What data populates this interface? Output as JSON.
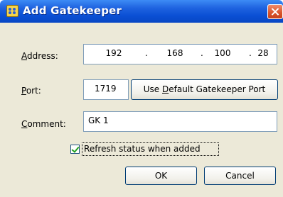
{
  "window": {
    "title": "Add Gatekeeper"
  },
  "address": {
    "label_mnemonic": "A",
    "label_rest": "ddress:",
    "octets": [
      "192",
      "168",
      "100",
      "28"
    ],
    "separator": "."
  },
  "port": {
    "label_mnemonic": "P",
    "label_rest": "ort:",
    "value": "1719",
    "default_button_pre": "Use ",
    "default_button_mnemonic": "D",
    "default_button_post": "efault Gatekeeper Port"
  },
  "comment": {
    "label_mnemonic": "C",
    "label_rest": "omment:",
    "value": "GK 1"
  },
  "refresh_checkbox": {
    "label_mnemonic": "R",
    "label_rest": "efresh status when added",
    "checked": true
  },
  "buttons": {
    "ok_label": "OK",
    "cancel_label": "Cancel"
  },
  "colors": {
    "titlebar": "#0a4fd4",
    "dialog_bg": "#ece9d8",
    "field_border": "#7f9db9",
    "button_border": "#003c74",
    "close_button": "#d9532a",
    "checkmark": "#21a121"
  },
  "icons": {
    "app": "gatekeeper-app-icon",
    "close": "close-icon",
    "check": "checkmark-icon"
  }
}
